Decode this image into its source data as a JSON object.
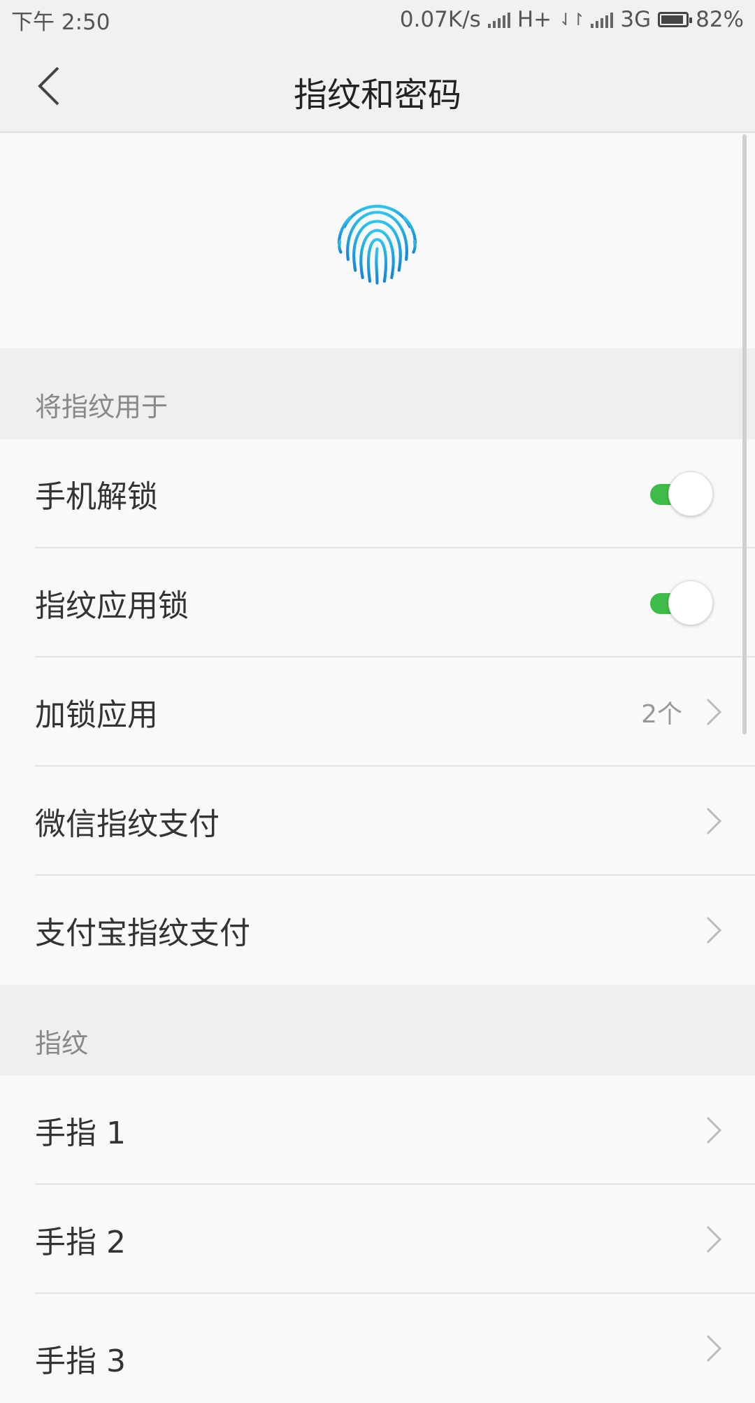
{
  "status_bar": {
    "time": "下午 2:50",
    "net_speed": "0.07K/s",
    "network_1": "H+",
    "network_2": "3G",
    "battery": "82%"
  },
  "header": {
    "title": "指纹和密码"
  },
  "sections": [
    {
      "header": "将指纹用于",
      "items": [
        {
          "label": "手机解锁",
          "toggle": true
        },
        {
          "label": "指纹应用锁",
          "toggle": true
        },
        {
          "label": "加锁应用",
          "value": "2个"
        },
        {
          "label": "微信指纹支付"
        },
        {
          "label": "支付宝指纹支付"
        }
      ]
    },
    {
      "header": "指纹",
      "items": [
        {
          "label": "手指 1"
        },
        {
          "label": "手指 2"
        },
        {
          "label": "手指 3"
        }
      ]
    }
  ],
  "colors": {
    "accent_toggle": "#3ebc4a",
    "fingerprint": "#1ba7e0"
  }
}
